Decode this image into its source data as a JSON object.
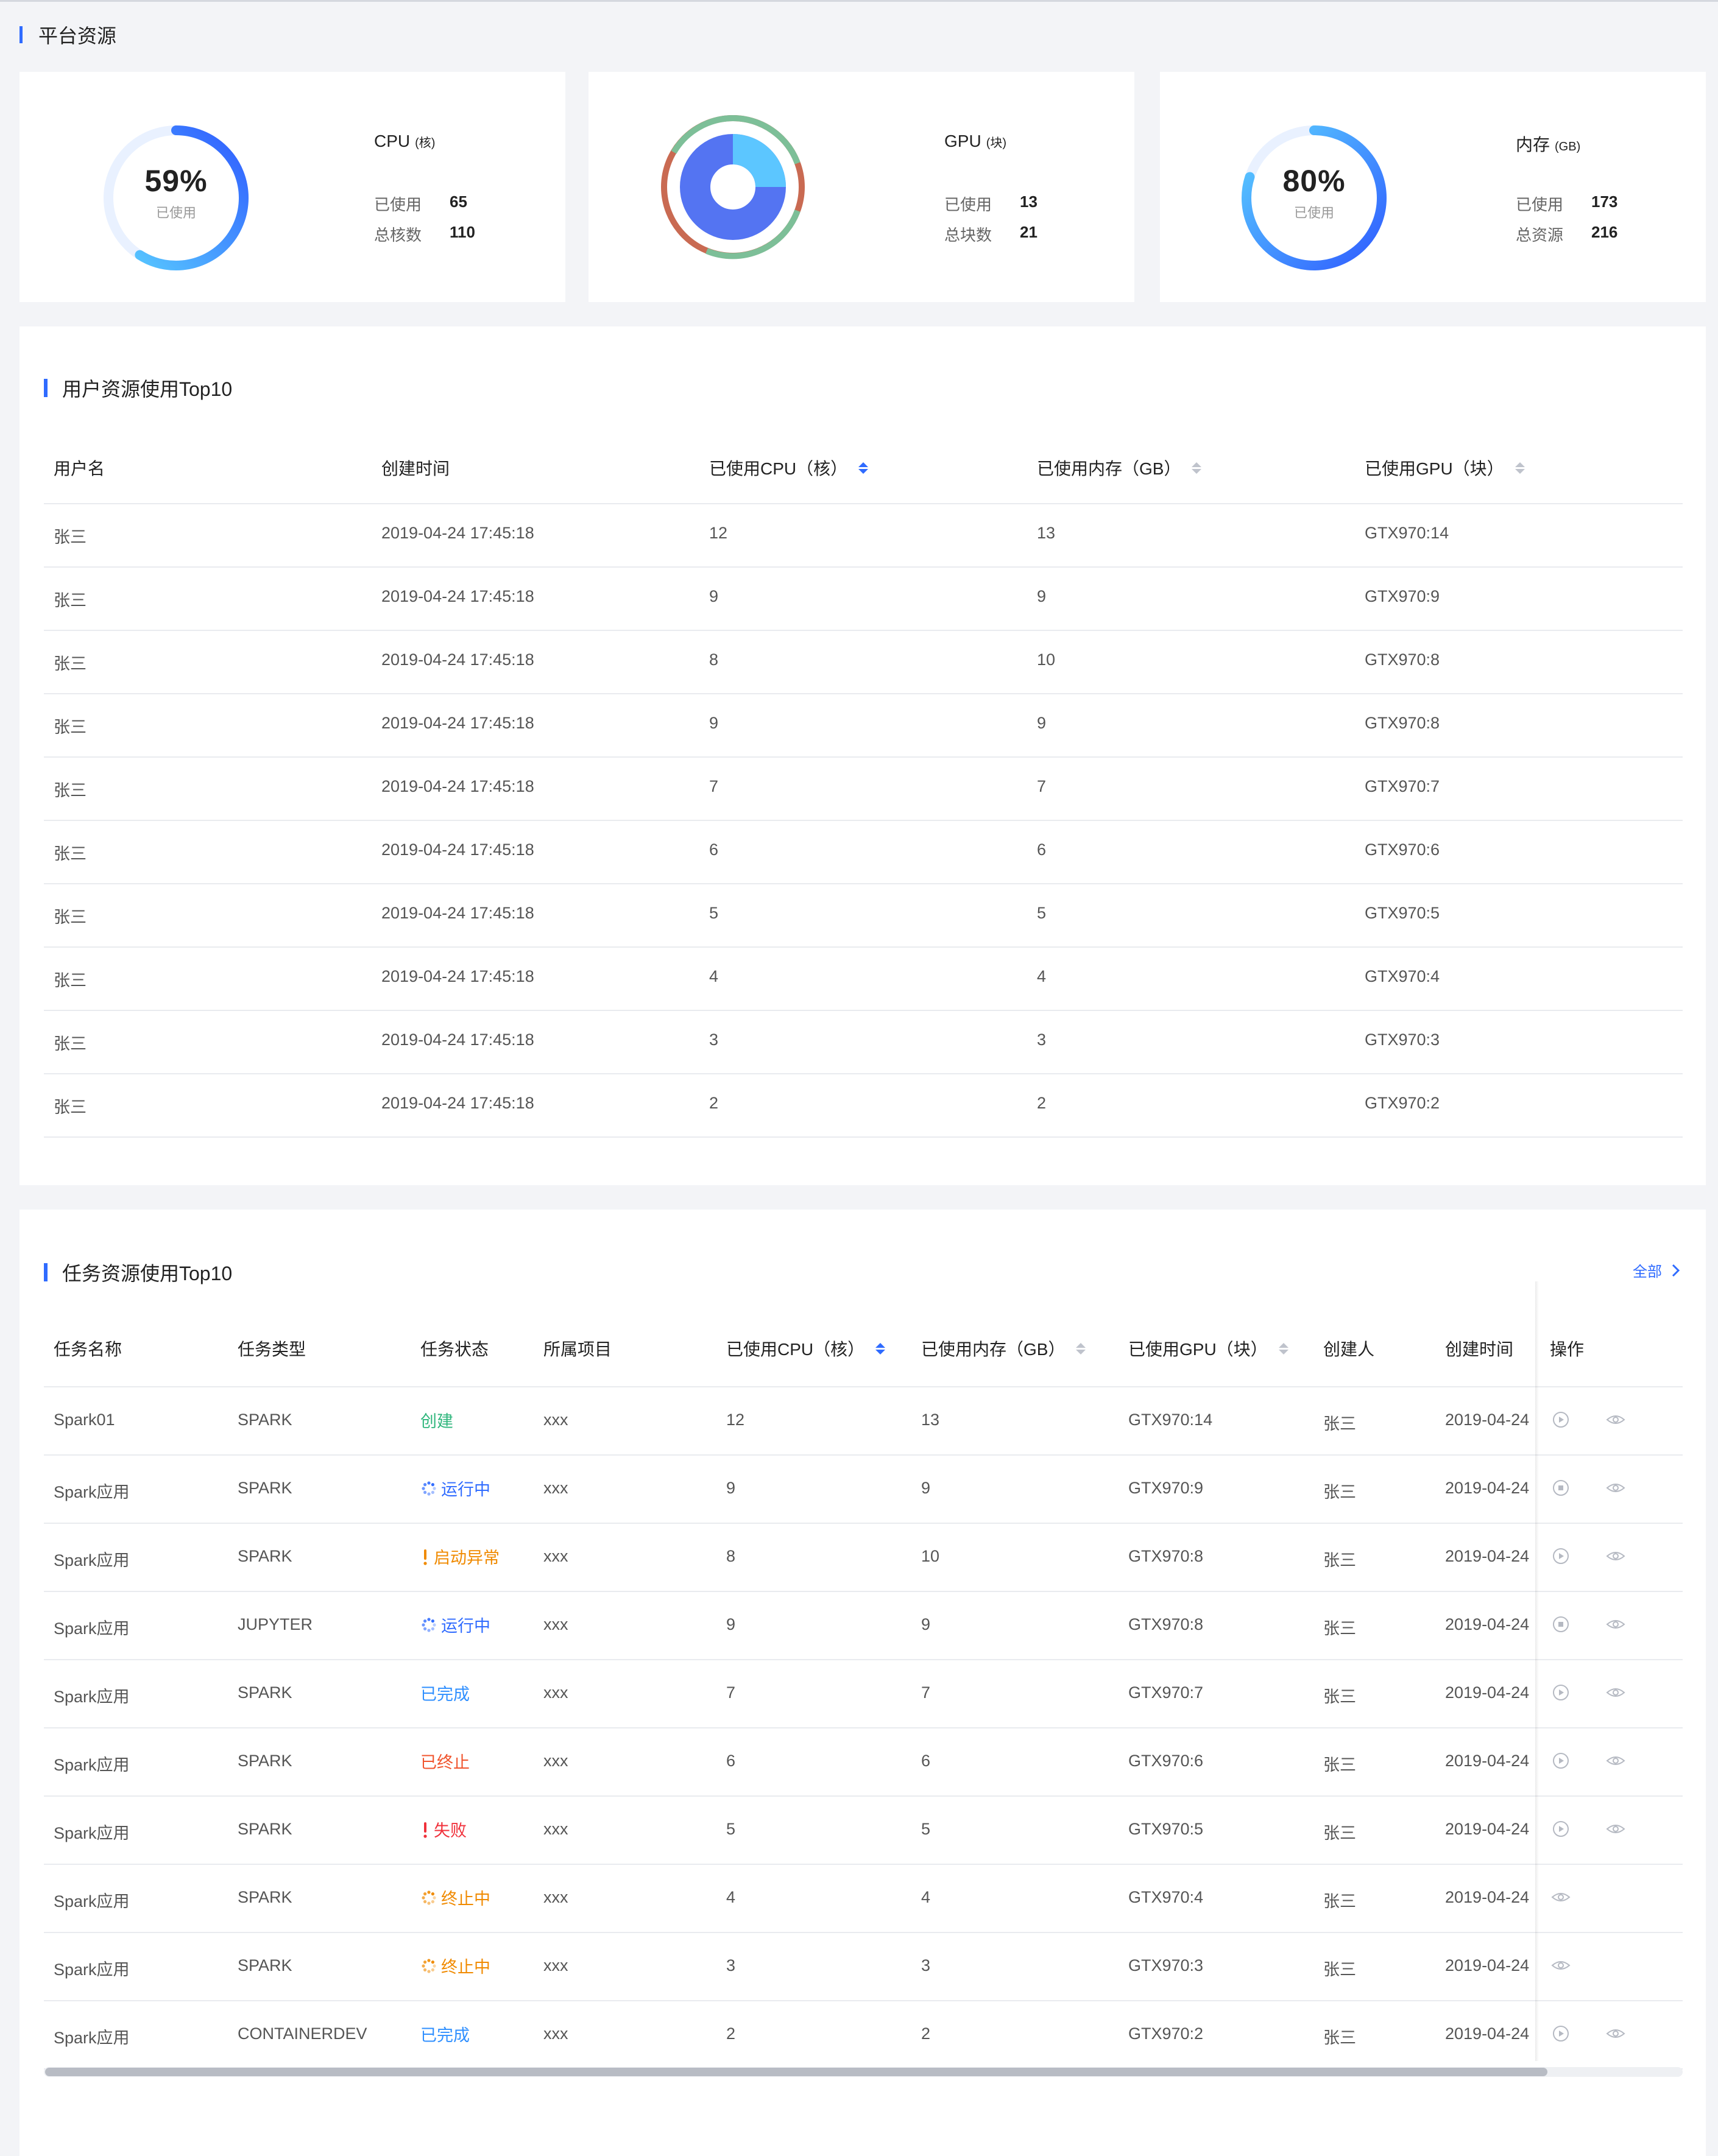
{
  "platform": {
    "title": "平台资源",
    "cpu": {
      "title": "CPU",
      "unit": "(核)",
      "percent": "59%",
      "percent_value": 0.59,
      "sub": "已使用",
      "used_label": "已使用",
      "used": "65",
      "total_label": "总核数",
      "total": "110"
    },
    "gpu": {
      "title": "GPU",
      "unit": "(块)",
      "used_label": "已使用",
      "used": "13",
      "total_label": "总块数",
      "total": "21"
    },
    "mem": {
      "title": "内存",
      "unit": "(GB)",
      "percent": "80%",
      "percent_value": 0.8,
      "sub": "已使用",
      "used_label": "已使用",
      "used": "173",
      "total_label": "总资源",
      "total": "216"
    }
  },
  "users": {
    "title": "用户资源使用Top10",
    "headers": [
      "用户名",
      "创建时间",
      "已使用CPU（核）",
      "已使用内存（GB）",
      "已使用GPU（块）"
    ],
    "rows": [
      [
        "张三",
        "2019-04-24 17:45:18",
        "12",
        "13",
        "GTX970:14"
      ],
      [
        "张三",
        "2019-04-24 17:45:18",
        "9",
        "9",
        "GTX970:9"
      ],
      [
        "张三",
        "2019-04-24 17:45:18",
        "8",
        "10",
        "GTX970:8"
      ],
      [
        "张三",
        "2019-04-24 17:45:18",
        "9",
        "9",
        "GTX970:8"
      ],
      [
        "张三",
        "2019-04-24 17:45:18",
        "7",
        "7",
        "GTX970:7"
      ],
      [
        "张三",
        "2019-04-24 17:45:18",
        "6",
        "6",
        "GTX970:6"
      ],
      [
        "张三",
        "2019-04-24 17:45:18",
        "5",
        "5",
        "GTX970:5"
      ],
      [
        "张三",
        "2019-04-24 17:45:18",
        "4",
        "4",
        "GTX970:4"
      ],
      [
        "张三",
        "2019-04-24 17:45:18",
        "3",
        "3",
        "GTX970:3"
      ],
      [
        "张三",
        "2019-04-24 17:45:18",
        "2",
        "2",
        "GTX970:2"
      ]
    ]
  },
  "tasks": {
    "title": "任务资源使用Top10",
    "all_label": "全部",
    "headers": [
      "任务名称",
      "任务类型",
      "任务状态",
      "所属项目",
      "已使用CPU（核）",
      "已使用内存（GB）",
      "已使用GPU（块）",
      "创建人",
      "创建时间",
      "操作"
    ],
    "status_colors": {
      "created": "#2fb67c",
      "running": "#2f6bff",
      "error": "#f08a00",
      "done": "#2f8fff",
      "stopped": "#f0542d",
      "failed": "#f0303a",
      "stopping": "#f08a00"
    },
    "rows": [
      {
        "name": "Spark01",
        "type": "SPARK",
        "status": "创建",
        "status_kind": "created",
        "project": "xxx",
        "cpu": "12",
        "mem": "13",
        "gpu": "GTX970:14",
        "creator": "张三",
        "time": "2019-04-24",
        "op1": "play-icon",
        "op2": "eye-icon"
      },
      {
        "name": "Spark应用",
        "type": "SPARK",
        "status": "运行中",
        "status_kind": "running",
        "project": "xxx",
        "cpu": "9",
        "mem": "9",
        "gpu": "GTX970:9",
        "creator": "张三",
        "time": "2019-04-24",
        "op1": "stop-icon",
        "op2": "eye-icon"
      },
      {
        "name": "Spark应用",
        "type": "SPARK",
        "status": "启动异常",
        "status_kind": "error",
        "project": "xxx",
        "cpu": "8",
        "mem": "10",
        "gpu": "GTX970:8",
        "creator": "张三",
        "time": "2019-04-24",
        "op1": "play-icon",
        "op2": "eye-icon"
      },
      {
        "name": "Spark应用",
        "type": "JUPYTER",
        "status": "运行中",
        "status_kind": "running",
        "project": "xxx",
        "cpu": "9",
        "mem": "9",
        "gpu": "GTX970:8",
        "creator": "张三",
        "time": "2019-04-24",
        "op1": "stop-icon",
        "op2": "eye-icon"
      },
      {
        "name": "Spark应用",
        "type": "SPARK",
        "status": "已完成",
        "status_kind": "done",
        "project": "xxx",
        "cpu": "7",
        "mem": "7",
        "gpu": "GTX970:7",
        "creator": "张三",
        "time": "2019-04-24",
        "op1": "play-icon",
        "op2": "eye-icon"
      },
      {
        "name": "Spark应用",
        "type": "SPARK",
        "status": "已终止",
        "status_kind": "stopped",
        "project": "xxx",
        "cpu": "6",
        "mem": "6",
        "gpu": "GTX970:6",
        "creator": "张三",
        "time": "2019-04-24",
        "op1": "play-icon",
        "op2": "eye-icon"
      },
      {
        "name": "Spark应用",
        "type": "SPARK",
        "status": "失败",
        "status_kind": "failed",
        "project": "xxx",
        "cpu": "5",
        "mem": "5",
        "gpu": "GTX970:5",
        "creator": "张三",
        "time": "2019-04-24",
        "op1": "play-icon",
        "op2": "eye-icon"
      },
      {
        "name": "Spark应用",
        "type": "SPARK",
        "status": "终止中",
        "status_kind": "stopping",
        "project": "xxx",
        "cpu": "4",
        "mem": "4",
        "gpu": "GTX970:4",
        "creator": "张三",
        "time": "2019-04-24",
        "op1": "eye-icon",
        "op2": ""
      },
      {
        "name": "Spark应用",
        "type": "SPARK",
        "status": "终止中",
        "status_kind": "stopping",
        "project": "xxx",
        "cpu": "3",
        "mem": "3",
        "gpu": "GTX970:3",
        "creator": "张三",
        "time": "2019-04-24",
        "op1": "eye-icon",
        "op2": ""
      },
      {
        "name": "Spark应用",
        "type": "CONTAINERDEV",
        "status": "已完成",
        "status_kind": "done",
        "project": "xxx",
        "cpu": "2",
        "mem": "2",
        "gpu": "GTX970:2",
        "creator": "张三",
        "time": "2019-04-24",
        "op1": "play-icon",
        "op2": "eye-icon"
      }
    ]
  }
}
